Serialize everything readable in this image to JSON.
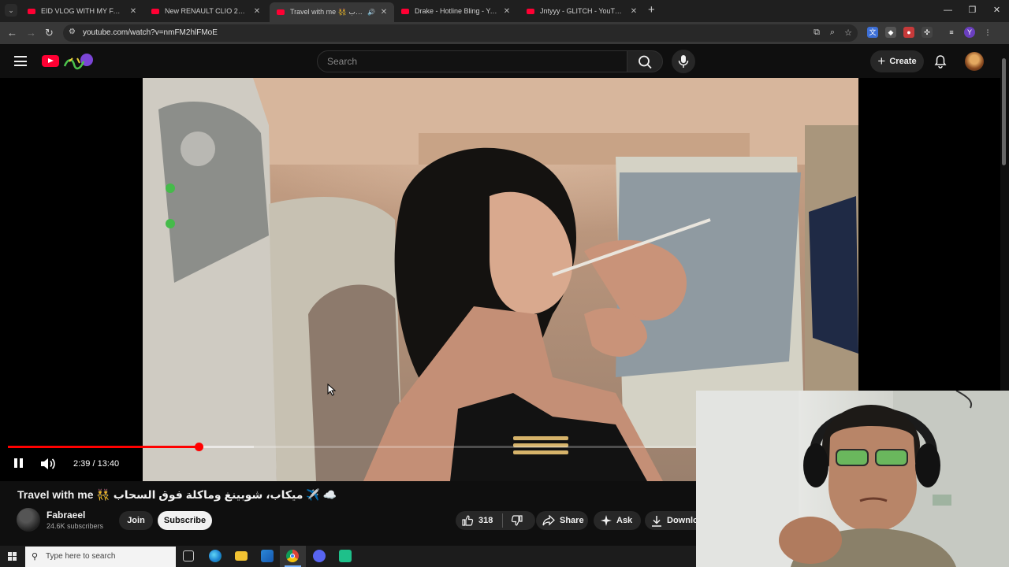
{
  "browser": {
    "tabs": [
      {
        "title": "EID VLOG WITH MY FAMILY I 😊",
        "active": false
      },
      {
        "title": "New RENAULT CLIO 2026 (Espr",
        "active": false
      },
      {
        "title": "Travel with me 👯 السحاب …",
        "active": true
      },
      {
        "title": "Drake - Hotline Bling - YouTube",
        "active": false
      },
      {
        "title": "Jntyyy - GLITCH - YouTube",
        "active": false
      }
    ],
    "new_tab_label": "+",
    "url": "youtube.com/watch?v=nmFM2hlFMoE",
    "window_controls": {
      "minimize": "—",
      "restore": "❐",
      "close": "✕"
    }
  },
  "youtube": {
    "search_placeholder": "Search",
    "create_label": "Create",
    "icons": [
      "menu-icon",
      "youtube-logo-icon",
      "search-icon",
      "mic-icon",
      "plus-icon",
      "bell-icon",
      "avatar-icon"
    ]
  },
  "player": {
    "current_time": "2:39",
    "duration": "13:40",
    "time_display": "2:39 / 13:40",
    "played_fraction": 0.194,
    "buffered_fraction": 0.25,
    "state": "playing"
  },
  "video": {
    "title": "Travel with me 👯 ميكاب، شوبينغ وماكلة فوق السحاب ✈️ ☁️",
    "channel_name": "Fabraeel",
    "subscribers": "24.6K subscribers",
    "join_label": "Join",
    "subscribe_label": "Subscribe",
    "like_count": "318",
    "share_label": "Share",
    "ask_label": "Ask",
    "download_label": "Download"
  },
  "taskbar": {
    "search_placeholder": "Type here to search",
    "apps": [
      "task-view-icon",
      "edge-icon",
      "file-explorer-icon",
      "store-icon",
      "chrome-icon",
      "discord-icon",
      "app-icon"
    ]
  },
  "colors": {
    "accent_red": "#ff0033",
    "progress_red": "#ff0000",
    "page_bg": "#0f0f0f"
  }
}
